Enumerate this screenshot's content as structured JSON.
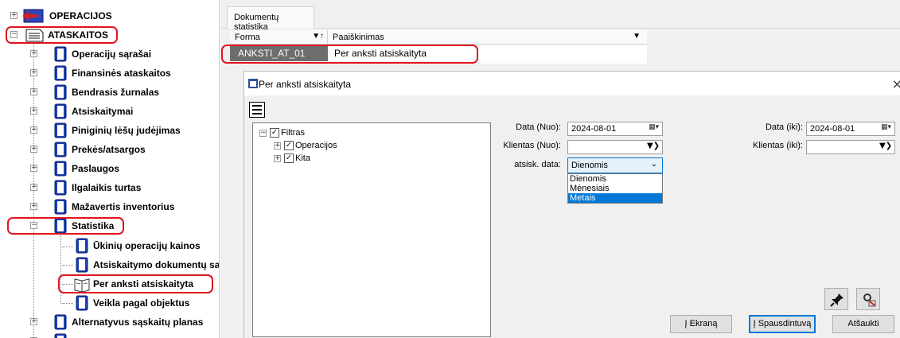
{
  "tree": {
    "items": [
      {
        "label": "OPERACIJOS"
      },
      {
        "label": "ATASKAITOS"
      },
      {
        "label": "Operacijų sąrašai"
      },
      {
        "label": "Finansinės ataskaitos"
      },
      {
        "label": "Bendrasis žurnalas"
      },
      {
        "label": "Atsiskaitymai"
      },
      {
        "label": "Piniginių lėšų judėjimas"
      },
      {
        "label": "Prekės/atsargos"
      },
      {
        "label": "Paslaugos"
      },
      {
        "label": "Ilgalaikis turtas"
      },
      {
        "label": "Mažavertis inventorius"
      },
      {
        "label": "Statistika"
      },
      {
        "label": "Ūkinių operacijų kainos"
      },
      {
        "label": "Atsiskaitymo dokumentų sa"
      },
      {
        "label": "Per anksti atsiskaityta"
      },
      {
        "label": "Veikla pagal objektus"
      },
      {
        "label": "Alternatyvus sąskaitų planas"
      }
    ]
  },
  "tab": {
    "label": "Dokumentų statistika"
  },
  "grid": {
    "columns": [
      "Forma",
      "Paaiškinimas"
    ],
    "row": {
      "code": "ANKSTI_AT_01",
      "description": "Per anksti atsiskaityta"
    }
  },
  "dialog": {
    "title": "Per anksti atsiskaityta",
    "close": "×",
    "filter_tree": {
      "root": "Filtras",
      "children": [
        "Operacijos",
        "Kita"
      ]
    },
    "fields": {
      "date_from_label": "Data (Nuo):",
      "date_from_value": "2024-08-01",
      "date_to_label": "Data (iki):",
      "date_to_value": "2024-08-01",
      "client_from_label": "Klientas (Nuo):",
      "client_to_label": "Klientas (iki):",
      "settle_date_label": "atsisk. data:",
      "settle_date_value": "Dienomis",
      "settle_options": [
        "Dienomis",
        "Mėnesiais",
        "Metais"
      ]
    },
    "buttons": {
      "screen": "Į Ekraną",
      "printer": "Į Spausdintuvą",
      "cancel": "Atšaukti"
    }
  },
  "colors": {
    "highlight": "#e0141e",
    "selection": "#0078d7",
    "grid_selected": "#6d6d6d"
  }
}
